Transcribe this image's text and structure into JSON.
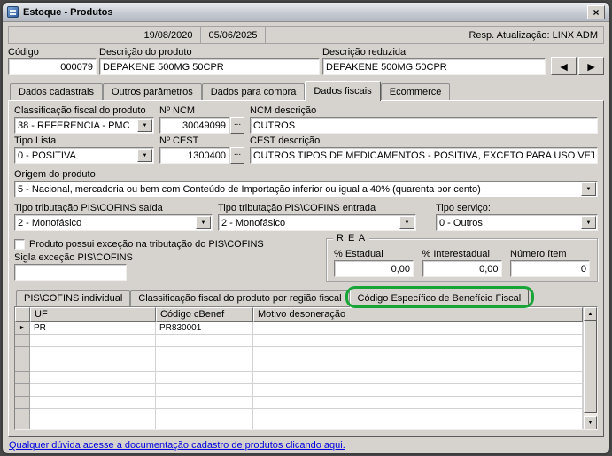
{
  "window": {
    "title": "Estoque - Produtos"
  },
  "icons": {
    "close": "×",
    "dropdown": "▼",
    "up": "▲",
    "down": "▼",
    "prev": "◄",
    "next": "►",
    "row_marker": "►",
    "lookup": "..."
  },
  "header": {
    "date_created": "19/08/2020",
    "date_updated": "05/06/2025",
    "responsavel": "Resp. Atualização: LINX ADM"
  },
  "product": {
    "codigo": {
      "label": "Código",
      "value": "000079"
    },
    "descricao": {
      "label": "Descrição do produto",
      "value": "DEPAKENE 500MG 50CPR"
    },
    "descricao_reduzida": {
      "label": "Descrição reduzida",
      "value": "DEPAKENE 500MG 50CPR"
    }
  },
  "tabs": [
    {
      "label": "Dados cadastrais",
      "active": false
    },
    {
      "label": "Outros parâmetros",
      "active": false
    },
    {
      "label": "Dados para compra",
      "active": false
    },
    {
      "label": "Dados fiscais",
      "active": true
    },
    {
      "label": "Ecommerce",
      "active": false
    }
  ],
  "fiscal": {
    "classificacao": {
      "label": "Classificação fiscal do produto",
      "value": "38 - REFERENCIA - PMC"
    },
    "ncm": {
      "label": "Nº NCM",
      "value": "30049099"
    },
    "ncm_descricao": {
      "label": "NCM descrição",
      "value": "OUTROS"
    },
    "tipo_lista": {
      "label": "Tipo Lista",
      "value": "0 - POSITIVA"
    },
    "cest": {
      "label": "Nº CEST",
      "value": "1300400"
    },
    "cest_descricao": {
      "label": "CEST descrição",
      "value": "OUTROS TIPOS DE MEDICAMENTOS - POSITIVA, EXCETO PARA USO VETERINÁRIO"
    },
    "origem": {
      "label": "Origem do produto",
      "value": "5 - Nacional, mercadoria ou bem com Conteúdo de Importação inferior ou igual a 40% (quarenta por cento)"
    },
    "pis_saida": {
      "label": "Tipo tributação PIS\\COFINS saída",
      "value": "2 - Monofásico"
    },
    "pis_entrada": {
      "label": "Tipo tributação PIS\\COFINS entrada",
      "value": "2 - Monofásico"
    },
    "tipo_servico": {
      "label": "Tipo serviço:",
      "value": "0 - Outros"
    },
    "excecao": {
      "checkbox_label": "Produto possui exceção na tributação do PIS\\COFINS",
      "checked": false,
      "sigla_label": "Sigla exceção PIS\\COFINS",
      "sigla_value": ""
    },
    "rea": {
      "title": "R E A",
      "estadual_label": "% Estadual",
      "estadual_value": "0,00",
      "interestadual_label": "% Interestadual",
      "interestadual_value": "0,00",
      "numero_item_label": "Número ítem",
      "numero_item_value": "0"
    }
  },
  "subtabs": [
    {
      "label": "PIS\\COFINS individual",
      "active": false,
      "highlighted": false
    },
    {
      "label": "Classificação fiscal do produto por região fiscal",
      "active": false,
      "highlighted": false
    },
    {
      "label": "Código Específico de Benefício Fiscal",
      "active": true,
      "highlighted": true
    }
  ],
  "grid": {
    "columns": [
      "UF",
      "Código cBenef",
      "Motivo desoneração"
    ],
    "rows": [
      {
        "uf": "PR",
        "cbenef": "PR830001",
        "motivo": ""
      }
    ]
  },
  "footer": {
    "link": "Qualquer dúvida acesse a documentação cadastro de produtos clicando aqui."
  }
}
